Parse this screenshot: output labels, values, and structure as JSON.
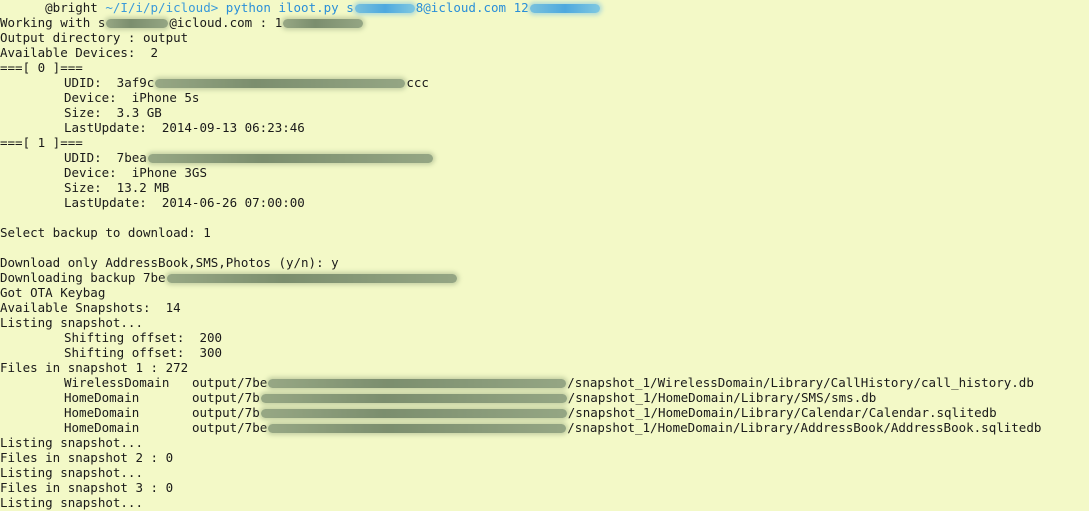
{
  "prompt": {
    "host": "@bright",
    "path": "~/I/i/p/icloud>",
    "command": "python iloot.py",
    "arg_email_prefix": "s",
    "arg_email_suffix": "8@icloud.com",
    "arg_pass_prefix": "12"
  },
  "lines": {
    "working_prefix": "Working with ",
    "working_user_prefix": "s",
    "working_email": "@icloud.com : 1",
    "output_dir": "Output directory : output",
    "available_devices": "Available Devices:  2",
    "dev0_header": "===[ 0 ]===",
    "dev0_udid_label": "UDID:  3af9c",
    "dev0_udid_tail": "ccc",
    "dev0_device": "Device:  iPhone 5s",
    "dev0_size": "Size:  3.3 GB",
    "dev0_lastupdate": "LastUpdate:  2014-09-13 06:23:46",
    "dev1_header": "===[ 1 ]===",
    "dev1_udid_label": "UDID:  7bea",
    "dev1_device": "Device:  iPhone 3GS",
    "dev1_size": "Size:  13.2 MB",
    "dev1_lastupdate": "LastUpdate:  2014-06-26 07:00:00",
    "select_backup": "Select backup to download: 1",
    "download_only": "Download only AddressBook,SMS,Photos (y/n): y",
    "downloading_prefix": "Downloading backup 7be",
    "got_keybag": "Got OTA Keybag",
    "available_snapshots": "Available Snapshots:  14",
    "listing1": "Listing snapshot...",
    "shift1": "Shifting offset:  200",
    "shift2": "Shifting offset:  300",
    "files_snap1": "Files in snapshot 1 : 272",
    "listing2": "Listing snapshot...",
    "files_snap2": "Files in snapshot 2 : 0",
    "listing3": "Listing snapshot...",
    "files_snap3": "Files in snapshot 3 : 0",
    "listing4": "Listing snapshot..."
  },
  "files": [
    {
      "domain": "WirelessDomain",
      "prefix": "output/7be",
      "path": "/snapshot_1/WirelessDomain/Library/CallHistory/call_history.db"
    },
    {
      "domain": "HomeDomain",
      "prefix": "output/7b",
      "path": "/snapshot_1/HomeDomain/Library/SMS/sms.db"
    },
    {
      "domain": "HomeDomain",
      "prefix": "output/7b",
      "path": "/snapshot_1/HomeDomain/Library/Calendar/Calendar.sqlitedb"
    },
    {
      "domain": "HomeDomain",
      "prefix": "output/7be",
      "path": "/snapshot_1/HomeDomain/Library/AddressBook/AddressBook.sqlitedb"
    }
  ],
  "colors": {
    "background": "#f3f9c7",
    "text": "#1a1a1a",
    "prompt_blue": "#2a8fd8"
  }
}
